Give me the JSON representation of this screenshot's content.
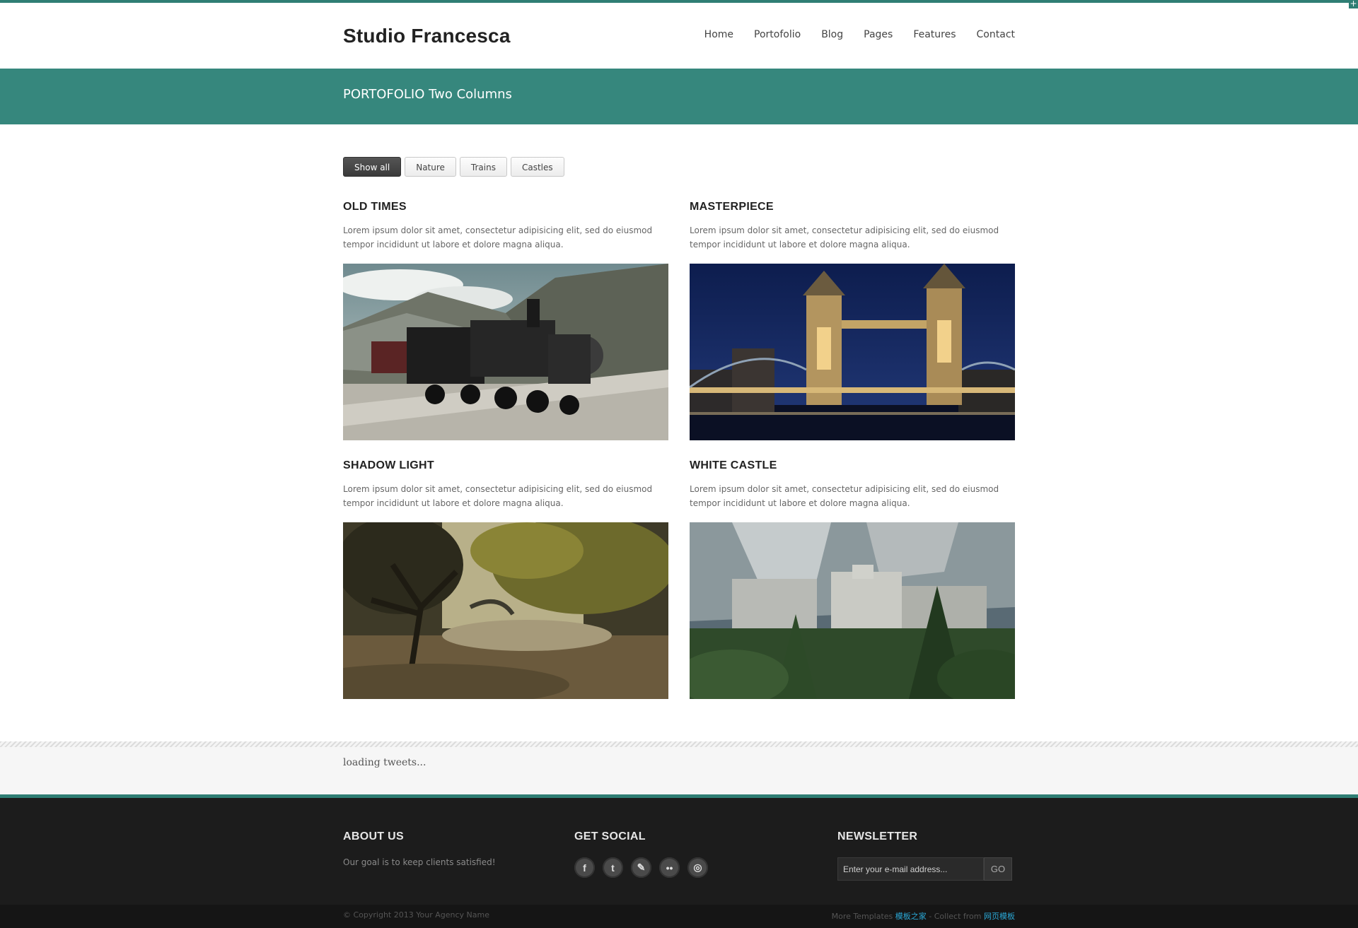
{
  "header": {
    "logo": "Studio Francesca",
    "nav": [
      "Home",
      "Portofolio",
      "Blog",
      "Pages",
      "Features",
      "Contact"
    ]
  },
  "banner": {
    "title": "PORTOFOLIO Two Columns"
  },
  "filters": [
    "Show all",
    "Nature",
    "Trains",
    "Castles"
  ],
  "items": [
    {
      "title": "OLD TIMES",
      "desc": "Lorem ipsum dolor sit amet, consectetur adipisicing elit, sed do eiusmod tempor incididunt ut labore et dolore magna aliqua."
    },
    {
      "title": "MASTERPIECE",
      "desc": "Lorem ipsum dolor sit amet, consectetur adipisicing elit, sed do eiusmod tempor incididunt ut labore et dolore magna aliqua."
    },
    {
      "title": "SHADOW LIGHT",
      "desc": "Lorem ipsum dolor sit amet, consectetur adipisicing elit, sed do eiusmod tempor incididunt ut labore et dolore magna aliqua."
    },
    {
      "title": "WHITE CASTLE",
      "desc": "Lorem ipsum dolor sit amet, consectetur adipisicing elit, sed do eiusmod tempor incididunt ut labore et dolore magna aliqua."
    }
  ],
  "tweets": {
    "status": "loading tweets..."
  },
  "footer": {
    "about": {
      "heading": "ABOUT US",
      "text": "Our goal is to keep clients satisfied!"
    },
    "social": {
      "heading": "GET SOCIAL",
      "icons": [
        "facebook-icon",
        "twitter-icon",
        "pen-icon",
        "flickr-icon",
        "dribbble-icon"
      ]
    },
    "newsletter": {
      "heading": "NEWSLETTER",
      "placeholder": "Enter your e-mail address...",
      "button": "GO"
    },
    "copyright": "© Copyright 2013 Your Agency Name",
    "credits": {
      "prefix": "More Templates ",
      "link1": "模板之家",
      "middle": " - Collect from ",
      "link2": "网页模板"
    }
  },
  "colors": {
    "accent": "#36877d",
    "footer_bg": "#1c1c1c"
  }
}
